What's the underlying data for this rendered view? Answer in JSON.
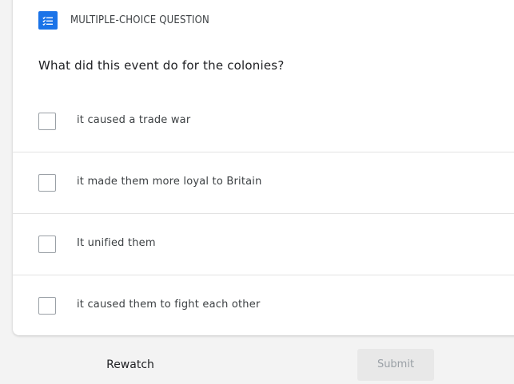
{
  "header": {
    "icon": "checklist-icon",
    "label": "MULTIPLE-CHOICE QUESTION",
    "icon_color": "#1a73e8"
  },
  "question": {
    "text": "What did this event do for the colonies?"
  },
  "options": [
    {
      "label": "it caused a trade war",
      "checked": false
    },
    {
      "label": "it made them more loyal to Britain",
      "checked": false
    },
    {
      "label": "It unified them",
      "checked": false
    },
    {
      "label": "it caused them to fight each other",
      "checked": false
    }
  ],
  "footer": {
    "rewatch_label": "Rewatch",
    "submit_label": "Submit",
    "submit_enabled": false
  }
}
